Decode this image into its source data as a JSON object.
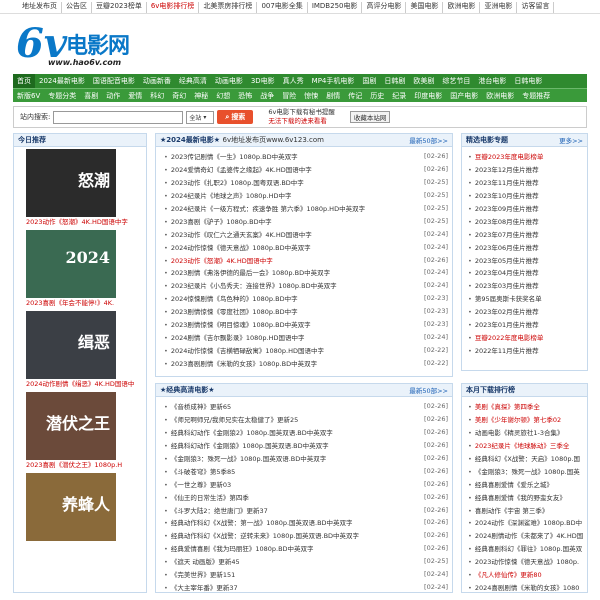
{
  "topbar": [
    {
      "label": "地址发布页",
      "hot": false
    },
    {
      "label": "公告区",
      "hot": false
    },
    {
      "label": "豆瓣2023榜单",
      "hot": false
    },
    {
      "label": "6v电影排行榜",
      "hot": true
    },
    {
      "label": "北美票房排行榜",
      "hot": false
    },
    {
      "label": "007电影全集",
      "hot": false
    },
    {
      "label": "IMDB250电影",
      "hot": false
    },
    {
      "label": "高评分电影",
      "hot": false
    },
    {
      "label": "美国电影",
      "hot": false
    },
    {
      "label": "欧洲电影",
      "hot": false
    },
    {
      "label": "亚洲电影",
      "hot": false
    },
    {
      "label": "访客留言",
      "hot": false
    }
  ],
  "logo": {
    "six": "6v",
    "cn": "电影网",
    "url": "www.hao6v.com"
  },
  "nav": {
    "row1": [
      "首页",
      "2024最新电影",
      "国语配音电影",
      "动画新番",
      "经典高清",
      "动画电影",
      "3D电影",
      "真人秀",
      "MP4手机电影",
      "国剧",
      "日韩剧",
      "欧美剧",
      "综艺节目",
      "港台电影",
      "日韩电影"
    ],
    "row2": [
      "新版6V",
      "专题分类",
      "喜剧",
      "动作",
      "爱情",
      "科幻",
      "奇幻",
      "神秘",
      "幻想",
      "恐怖",
      "战争",
      "冒险",
      "惊悚",
      "剧情",
      "传记",
      "历史",
      "纪录",
      "印度电影",
      "国产电影",
      "欧洲电影",
      "专题推荐"
    ]
  },
  "search": {
    "label": "站内搜索:",
    "value": "",
    "select": "全站",
    "button": "搜索",
    "note1": "6v电影下载有秘书提醒",
    "note2": "无法下载的进来看看",
    "fav": "收藏本站网"
  },
  "today": {
    "title": "今日推荐",
    "posters": [
      {
        "caption": "2023动作《怒潮》4K.HD国语中字",
        "text": "怒潮",
        "bg": "#2b2b2b"
      },
      {
        "caption": "2023喜剧《年会不能停!》4K.",
        "text": "2024",
        "bg": "#3a6a52"
      },
      {
        "caption": "2024动作剧情《缉恶》4K.HD国语中",
        "text": "缉恶",
        "bg": "#3b3f45"
      },
      {
        "caption": "2023喜剧《潜伏之王》1080p.H",
        "text": "潜伏之王",
        "bg": "#6b4a3a"
      },
      {
        "caption": "",
        "text": "养蜂人",
        "bg": "#8a6a3a"
      }
    ]
  },
  "latest": {
    "title": "★2024最新电影★",
    "subtitle": "6v地址发布页www.6v123.com",
    "more": "最新50部>>",
    "items": [
      {
        "t": "2023传记剧情《一生》1080p.BD中英双字",
        "d": "[02-26]",
        "red": false
      },
      {
        "t": "2024爱情奇幻《孟婆传之缘起》4K.HD国语中字",
        "d": "[02-26]",
        "red": false
      },
      {
        "t": "2023动作《扎职2》1080p.国粤双语.BD中字",
        "d": "[02-25]",
        "red": false
      },
      {
        "t": "2024纪录片《地球之声》1080p.HD中字",
        "d": "[02-25]",
        "red": false
      },
      {
        "t": "2024纪录片《一级方程式：疾速争胜 第六季》1080p.HD中英双字",
        "d": "[02-25]",
        "red": false
      },
      {
        "t": "2023喜剧《驴子》1080p.BD中字",
        "d": "[02-25]",
        "red": false
      },
      {
        "t": "2023动作《叹仁六之通天玄案》4K.HD国语中字",
        "d": "[02-24]",
        "red": false
      },
      {
        "t": "2024动作惊悚《德天意战》1080p.BD中英双字",
        "d": "[02-24]",
        "red": false
      },
      {
        "t": "2023动作《怒潮》4K.HD国语中字",
        "d": "[02-26]",
        "red": true
      },
      {
        "t": "2023剧情《弗洛伊德的最后一会》1080p.BD中英双字",
        "d": "[02-24]",
        "red": false
      },
      {
        "t": "2023纪录片《小岛秀夫：连接世界》1080p.BD中英双字",
        "d": "[02-24]",
        "red": false
      },
      {
        "t": "2024惊悚剧情《鸟色种的》1080p.BD中字",
        "d": "[02-23]",
        "red": false
      },
      {
        "t": "2023剧情惊悚《零度社团》1080p.BD中字",
        "d": "[02-23]",
        "red": false
      },
      {
        "t": "2023剧情惊悚《明目惊魂》1080p.BD中英双字",
        "d": "[02-23]",
        "red": false
      },
      {
        "t": "2024剧情《吉尔飘影录》1080p.HD国语中字",
        "d": "[02-24]",
        "red": false
      },
      {
        "t": "2024动作惊悚《吉横牺碌敌寓》1080p.HD国语中字",
        "d": "[02-22]",
        "red": false
      },
      {
        "t": "2023喜剧剧情《米勒的女孩》1080p.BD中英双字",
        "d": "[02-22]",
        "red": false
      }
    ]
  },
  "classic": {
    "title": "★经典高清电影★",
    "more": "最新50部>>",
    "items": [
      {
        "t": "《音桥成神》更新65",
        "d": "[02-26]"
      },
      {
        "t": "《师兄啊师兄/我师兄实在太稳健了》更新25",
        "d": "[02-26]"
      },
      {
        "t": "经典科幻动作《金刚狼2》1080p.国英双语.BD中英双字",
        "d": "[02-26]"
      },
      {
        "t": "经典科幻动作《金刚狼》1080p.国英双语.BD中英双字",
        "d": "[02-26]"
      },
      {
        "t": "《金刚狼3：殊死一战》1080p.国英双语.BD中英双字",
        "d": "[02-26]"
      },
      {
        "t": "《斗破苍穹》第5季85",
        "d": "[02-26]"
      },
      {
        "t": "《一世之尊》更新03",
        "d": "[02-26]"
      },
      {
        "t": "《仙王的日常生活》第四季",
        "d": "[02-26]"
      },
      {
        "t": "《斗罗大陆2：绝世唐门》更新37",
        "d": "[02-26]"
      },
      {
        "t": "经典动作科幻《X战警：第一战》1080p.国英双语.BD中英双字",
        "d": "[02-26]"
      },
      {
        "t": "经典动作科幻《X战警：逆转未来》1080p.国英双语.BD中英双字",
        "d": "[02-26]"
      },
      {
        "t": "经典爱情喜剧《我为玛丽狂》1080p.BD中英双字",
        "d": "[02-26]"
      },
      {
        "t": "《遮天 动画版》更新45",
        "d": "[02-25]"
      },
      {
        "t": "《完美世界》更新151",
        "d": "[02-24]"
      },
      {
        "t": "《大主宰年番》更新37",
        "d": "[02-24]"
      }
    ]
  },
  "topics": {
    "title": "精选电影专题",
    "more": "更多>>",
    "items": [
      {
        "t": "豆瓣2023年度电影榜单",
        "red": true
      },
      {
        "t": "2023年12月佳片推荐",
        "red": false
      },
      {
        "t": "2023年11月佳片推荐",
        "red": false
      },
      {
        "t": "2023年10月佳片推荐",
        "red": false
      },
      {
        "t": "2023年09月佳片推荐",
        "red": false
      },
      {
        "t": "2023年08月佳片推荐",
        "red": false
      },
      {
        "t": "2023年07月佳片推荐",
        "red": false
      },
      {
        "t": "2023年06月佳片推荐",
        "red": false
      },
      {
        "t": "2023年05月佳片推荐",
        "red": false
      },
      {
        "t": "2023年04月佳片推荐",
        "red": false
      },
      {
        "t": "2023年03月佳片推荐",
        "red": false
      },
      {
        "t": "第95届奥斯卡获奖名单",
        "red": false
      },
      {
        "t": "2023年02月佳片推荐",
        "red": false
      },
      {
        "t": "2023年01月佳片推荐",
        "red": false
      },
      {
        "t": "豆瓣2022年度电影榜单",
        "red": true
      },
      {
        "t": "2022年11月佳片推荐",
        "red": false
      }
    ]
  },
  "monthly": {
    "title": "本月下载排行榜",
    "items": [
      {
        "t": "美剧《真探》第四季全",
        "red": true
      },
      {
        "t": "美剧《少年谢尔顿》第七季02",
        "red": true
      },
      {
        "t": "动画电影《精灵旅社1-3合集》",
        "red": false
      },
      {
        "t": "2023纪录片《地球脉动》三季全",
        "red": true
      },
      {
        "t": "经典科幻《X战警：天启》1080p.国",
        "red": false
      },
      {
        "t": "《金刚狼3：殊死一战》1080p.国英",
        "red": false
      },
      {
        "t": "经典喜剧爱情《爱乐之城》",
        "red": false
      },
      {
        "t": "经典喜剧爱情《我的野蛮女友》",
        "red": false
      },
      {
        "t": "喜剧动作《宇宙 第三季》",
        "red": false
      },
      {
        "t": "2024动作《深渊鲨难》1080p.BD中",
        "red": false
      },
      {
        "t": "2024剧情动作《未都来了》4K.HD国",
        "red": false
      },
      {
        "t": "经典喜剧科幻《罪往》1080p.国英双",
        "red": false
      },
      {
        "t": "2023动作惊悚《德天意战》1080p.",
        "red": false
      },
      {
        "t": "《凡人修仙传》更新80",
        "red": true
      },
      {
        "t": "2024喜剧剧情《米勒的女孩》1080",
        "red": false
      }
    ]
  }
}
